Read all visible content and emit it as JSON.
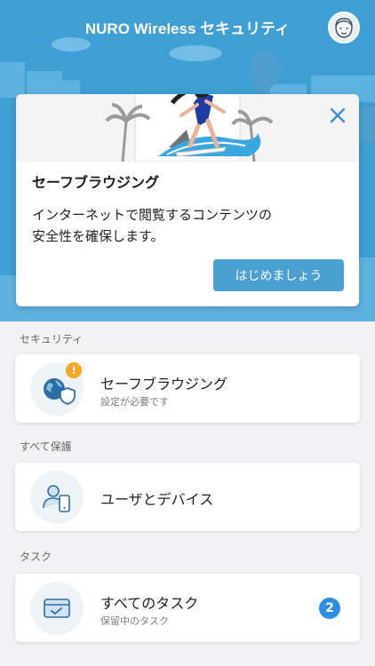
{
  "header": {
    "title": "NURO Wireless セキュリティ",
    "avatar_icon": "user-face-icon"
  },
  "overlay": {
    "title": "セーフブラウジング",
    "description_line1": "インターネットで閲覧するコンテンツの",
    "description_line2": "安全性を確保します。",
    "button_label": "はじめましょう",
    "close_icon": "close-icon"
  },
  "sections": {
    "security_label": "セキュリティ",
    "protection_label": "すべて保護",
    "tasks_label": "タスク"
  },
  "cards": {
    "safe_browsing": {
      "title": "セーフブラウジング",
      "subtitle": "設定が必要です",
      "badge": "!",
      "icon": "globe-shield-icon"
    },
    "users_devices": {
      "title": "ユーザとデバイス",
      "icon": "user-device-icon"
    },
    "all_tasks": {
      "title": "すべてのタスク",
      "subtitle": "保留中のタスク",
      "count": "2",
      "icon": "card-check-icon"
    }
  },
  "colors": {
    "header_bg": "#3d9fd6",
    "button": "#4aa0d3",
    "badge_warning": "#f5a623",
    "badge_count": "#2e8fe0"
  }
}
